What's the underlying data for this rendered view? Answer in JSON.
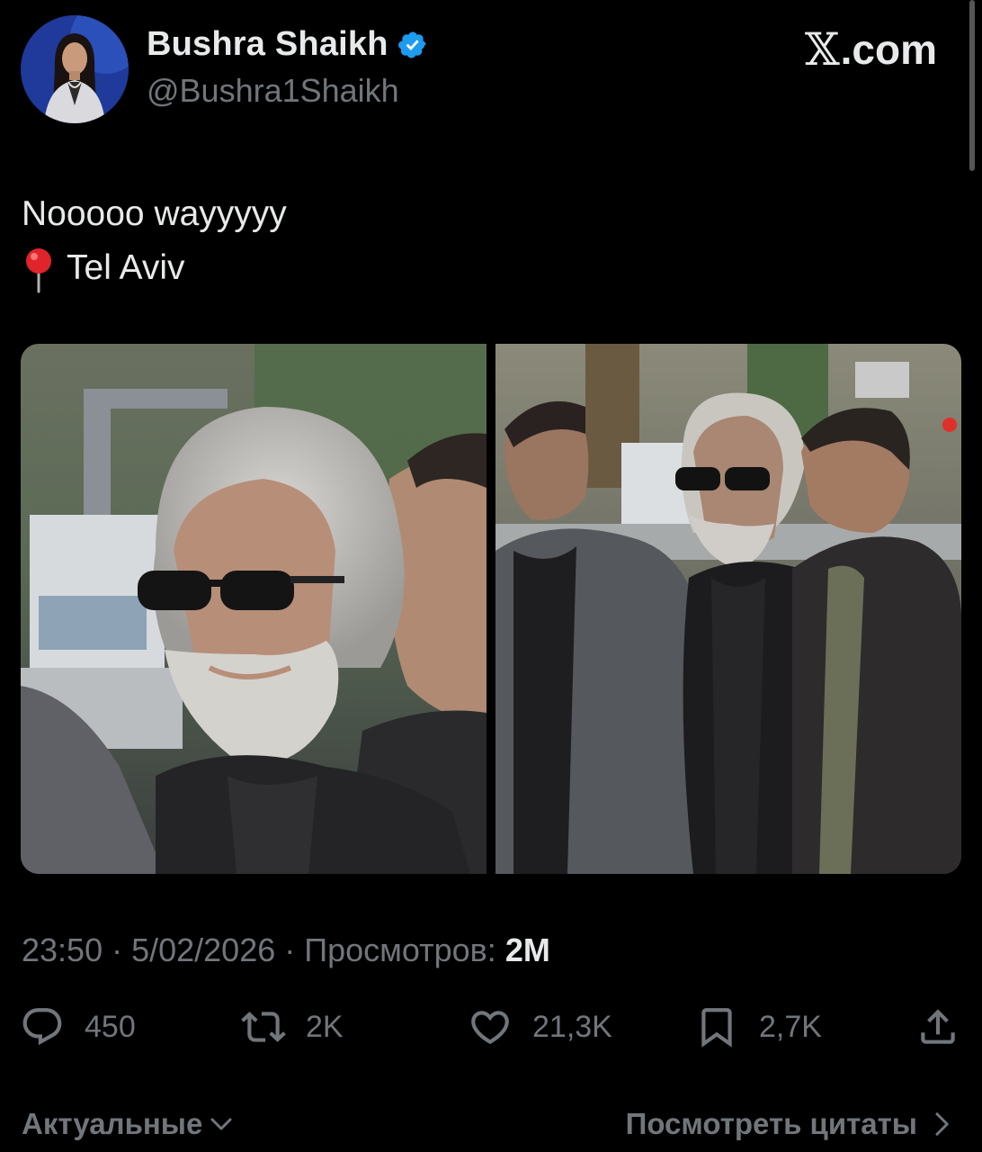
{
  "header": {
    "display_name": "Bushra Shaikh",
    "handle": "@Bushra1Shaikh",
    "verified": true,
    "brand_x": "𝕏",
    "brand_suffix": ".com"
  },
  "tweet": {
    "line1": "Nooooo wayyyyy",
    "location_icon": "round-pushpin-icon",
    "line2": "Tel Aviv"
  },
  "media": {
    "count": 2
  },
  "meta": {
    "time": "23:50",
    "sep1": " · ",
    "date": "5/02/2026",
    "sep2": " · ",
    "views_label": "Просмотров: ",
    "views_count": "2M"
  },
  "actions": {
    "replies": "450",
    "reposts": "2K",
    "likes": "21,3K",
    "bookmarks": "2,7K"
  },
  "footer": {
    "sort_label": "Актуальные",
    "quotes_label": "Посмотреть цитаты"
  },
  "colors": {
    "background": "#000000",
    "text_primary": "#e7e9ea",
    "text_secondary": "#71767b",
    "verified_blue": "#1d9bf0"
  }
}
